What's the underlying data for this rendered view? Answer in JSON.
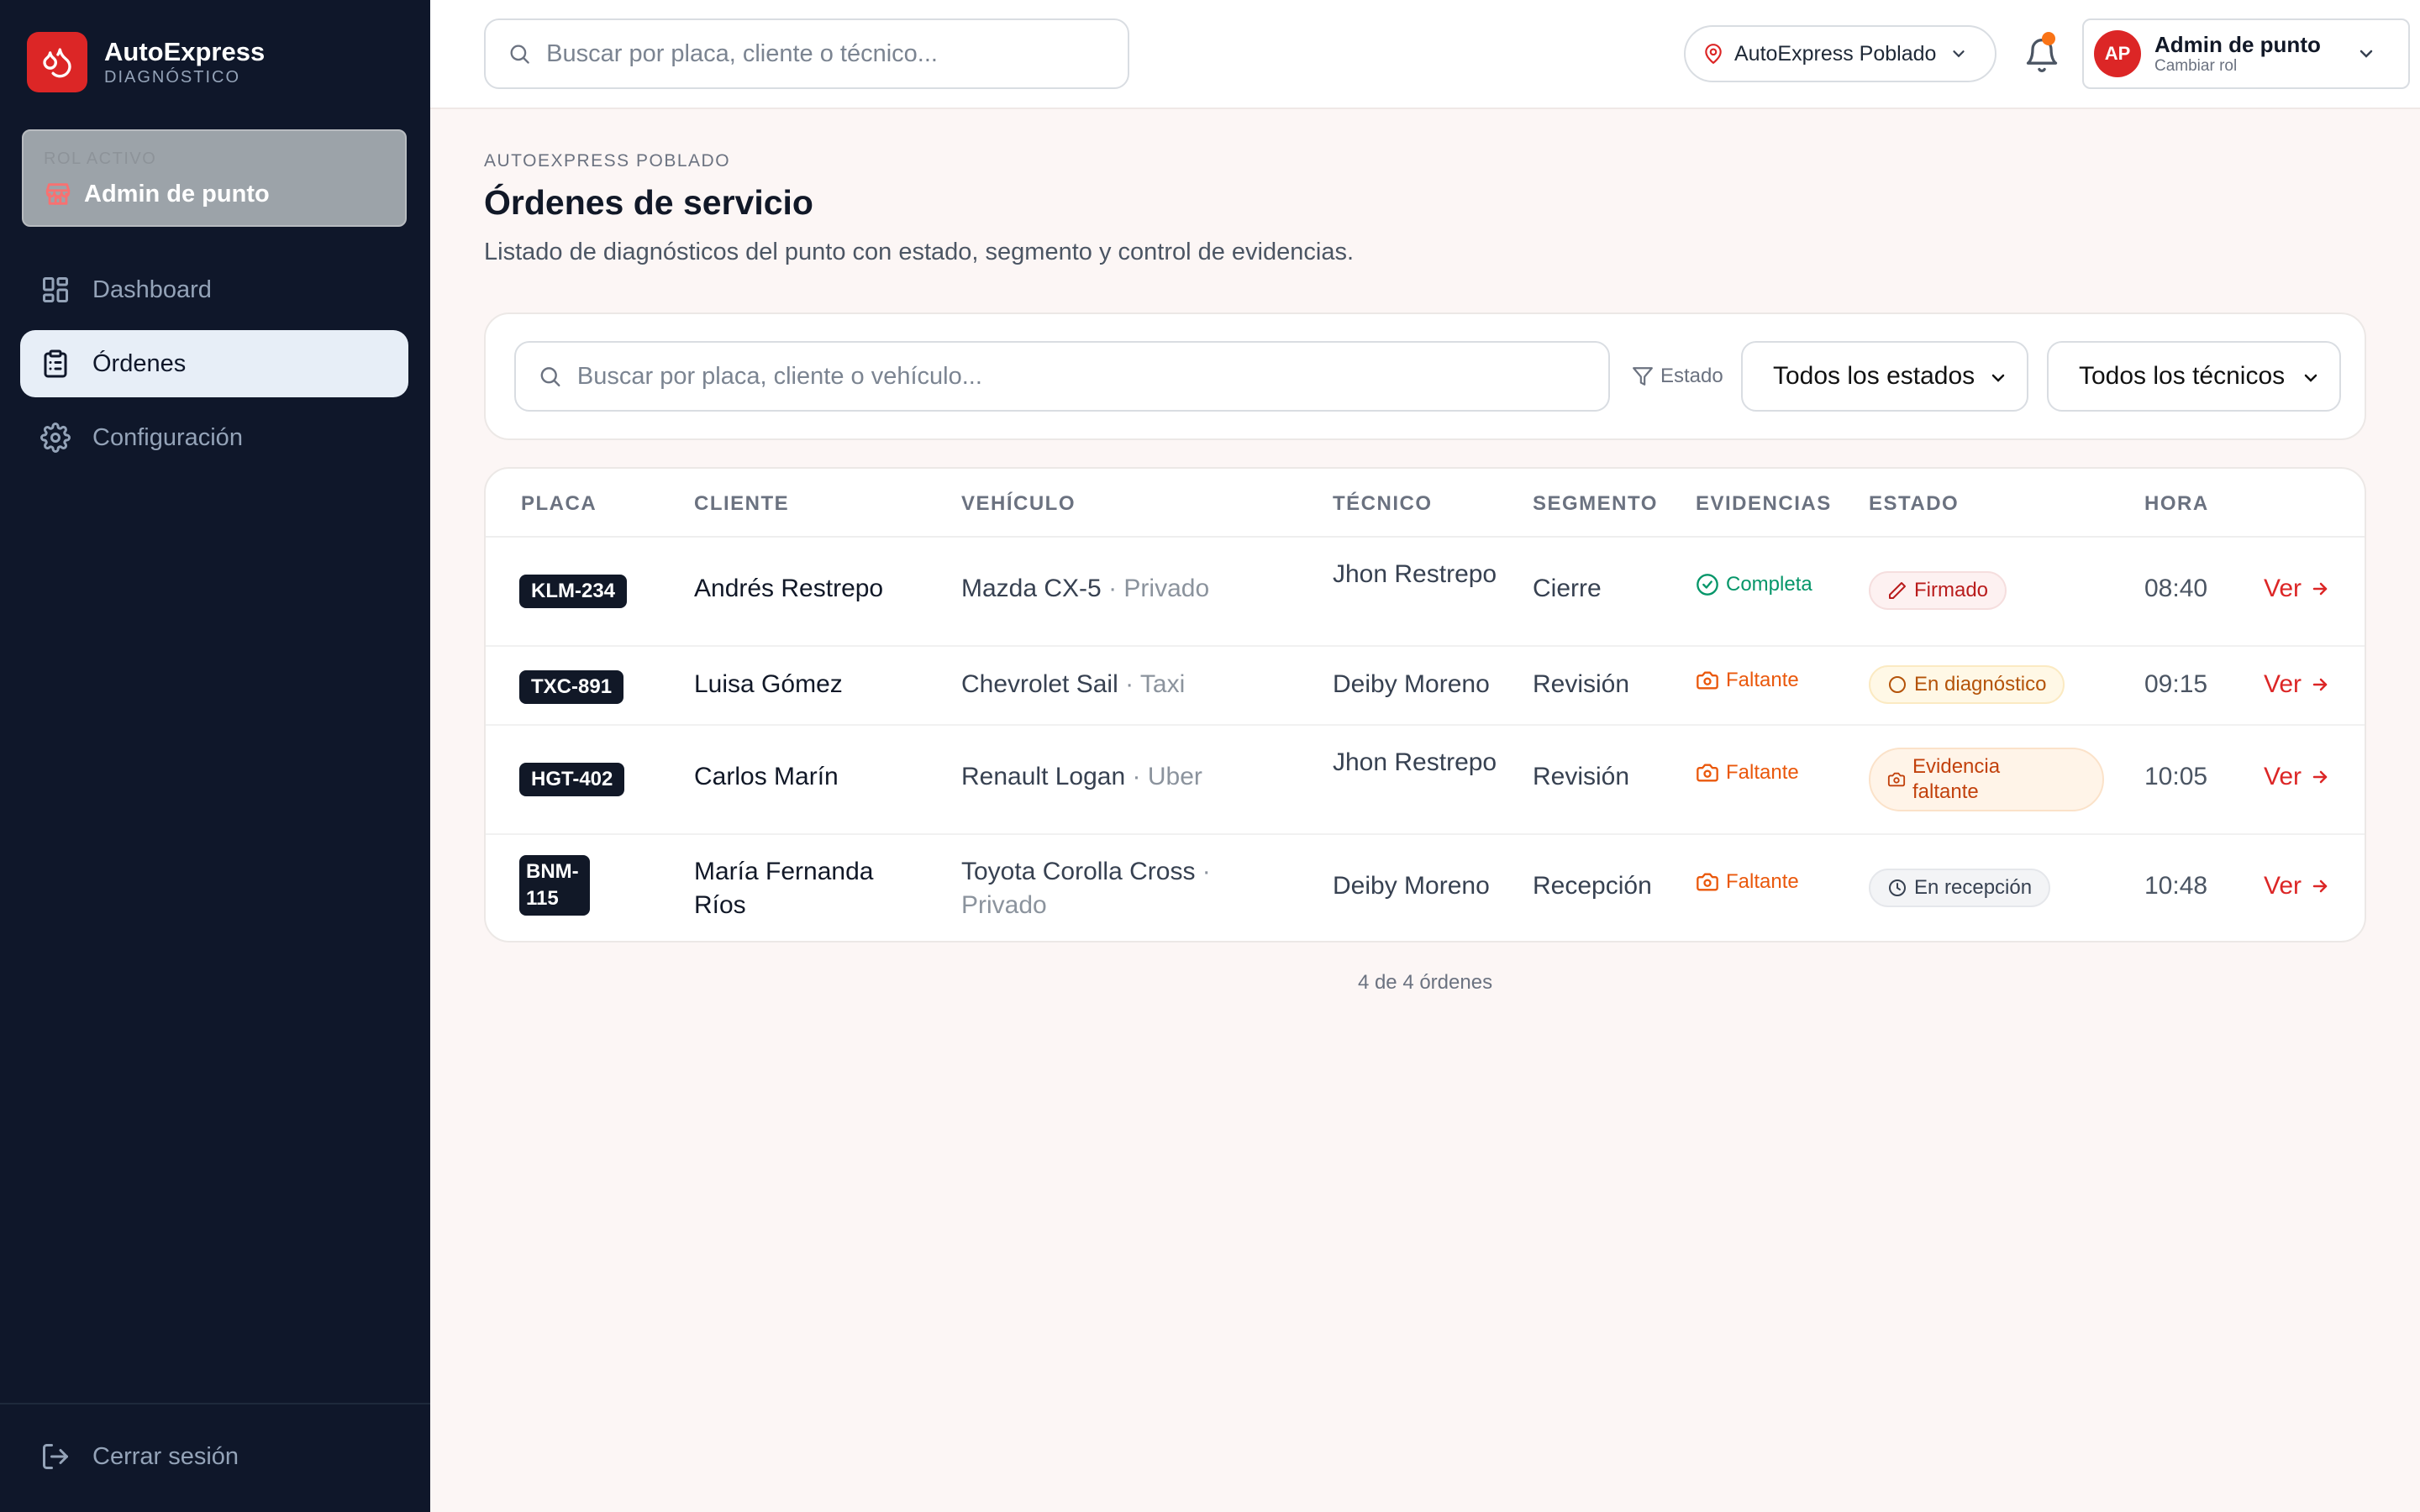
{
  "brand": {
    "name": "AutoExpress",
    "subtitle": "DIAGNÓSTICO"
  },
  "role": {
    "caption": "ROL ACTIVO",
    "name": "Admin de punto"
  },
  "nav": [
    {
      "label": "Dashboard",
      "icon": "grid-icon",
      "active": false
    },
    {
      "label": "Órdenes",
      "icon": "clipboard-icon",
      "active": true
    },
    {
      "label": "Configuración",
      "icon": "gear-icon",
      "active": false
    }
  ],
  "logout": {
    "label": "Cerrar sesión"
  },
  "topbar": {
    "search_placeholder": "Buscar por placa, cliente o técnico...",
    "location": "AutoExpress Poblado",
    "user": {
      "initials": "AP",
      "name": "Admin de punto",
      "sub": "Cambiar rol"
    }
  },
  "page": {
    "eyebrow": "AUTOEXPRESS POBLADO",
    "title": "Órdenes de servicio",
    "description": "Listado de diagnósticos del punto con estado, segmento y control de evidencias."
  },
  "filters": {
    "search_placeholder": "Buscar por placa, cliente o vehículo...",
    "estado_label": "Estado",
    "status_select": "Todos los estados",
    "tech_select": "Todos los técnicos"
  },
  "table": {
    "headers": [
      "PLACA",
      "CLIENTE",
      "VEHÍCULO",
      "TÉCNICO",
      "SEGMENTO",
      "EVIDENCIAS",
      "ESTADO",
      "HORA"
    ],
    "rows": [
      {
        "plate": "KLM-234",
        "client": "Andrés Restrepo",
        "vehicle": "Mazda CX-5",
        "vehicle_type": "· Privado",
        "tech": "Jhon Restrepo",
        "segment": "Cierre",
        "evidence": "Completa",
        "status": "Firmado",
        "hour": "08:40",
        "action": "Ver"
      },
      {
        "plate": "TXC-891",
        "client": "Luisa Gómez",
        "vehicle": "Chevrolet Sail",
        "vehicle_type": "· Taxi",
        "tech": "Deiby Moreno",
        "segment": "Revisión",
        "evidence": "Faltante",
        "status": "En diagnóstico",
        "hour": "09:15",
        "action": "Ver"
      },
      {
        "plate": "HGT-402",
        "client": "Carlos Marín",
        "vehicle": "Renault Logan",
        "vehicle_type": "· Uber",
        "tech": "Jhon Restrepo",
        "segment": "Revisión",
        "evidence": "Faltante",
        "status": "Evidencia faltante",
        "hour": "10:05",
        "action": "Ver"
      },
      {
        "plate": "BNM-115",
        "client": "María Fernanda Ríos",
        "vehicle": "Toyota Corolla Cross",
        "vehicle_type": "· Privado",
        "tech": "Deiby Moreno",
        "segment": "Recepción",
        "evidence": "Faltante",
        "status": "En recepción",
        "hour": "10:48",
        "action": "Ver"
      }
    ]
  },
  "footer": {
    "count": "4 de 4 órdenes"
  },
  "colors": {
    "brand": "#dc2626",
    "sidebar": "#0f172a",
    "success": "#059669",
    "warning": "#ea580c"
  }
}
